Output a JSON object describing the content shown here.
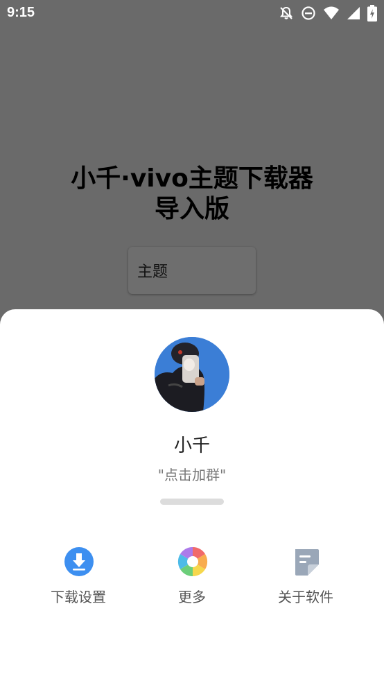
{
  "status_bar": {
    "time": "9:15",
    "icons": [
      "notifications-off-icon",
      "do-not-disturb-icon",
      "wifi-icon",
      "cellular-signal-icon",
      "battery-charging-icon"
    ]
  },
  "background_page": {
    "title_line1": "小千·vivo主题下载器",
    "title_line2": "导入版",
    "theme_button_label": "主题"
  },
  "sheet": {
    "profile_name": "小千",
    "profile_subtitle": "\"点击加群\"",
    "actions": [
      {
        "label": "下载设置",
        "icon": "download-icon",
        "color": "#3d8ff0"
      },
      {
        "label": "更多",
        "icon": "pinwheel-icon",
        "color": "#f05a5a"
      },
      {
        "label": "关于软件",
        "icon": "document-icon",
        "color": "#9aa7b8"
      }
    ]
  }
}
